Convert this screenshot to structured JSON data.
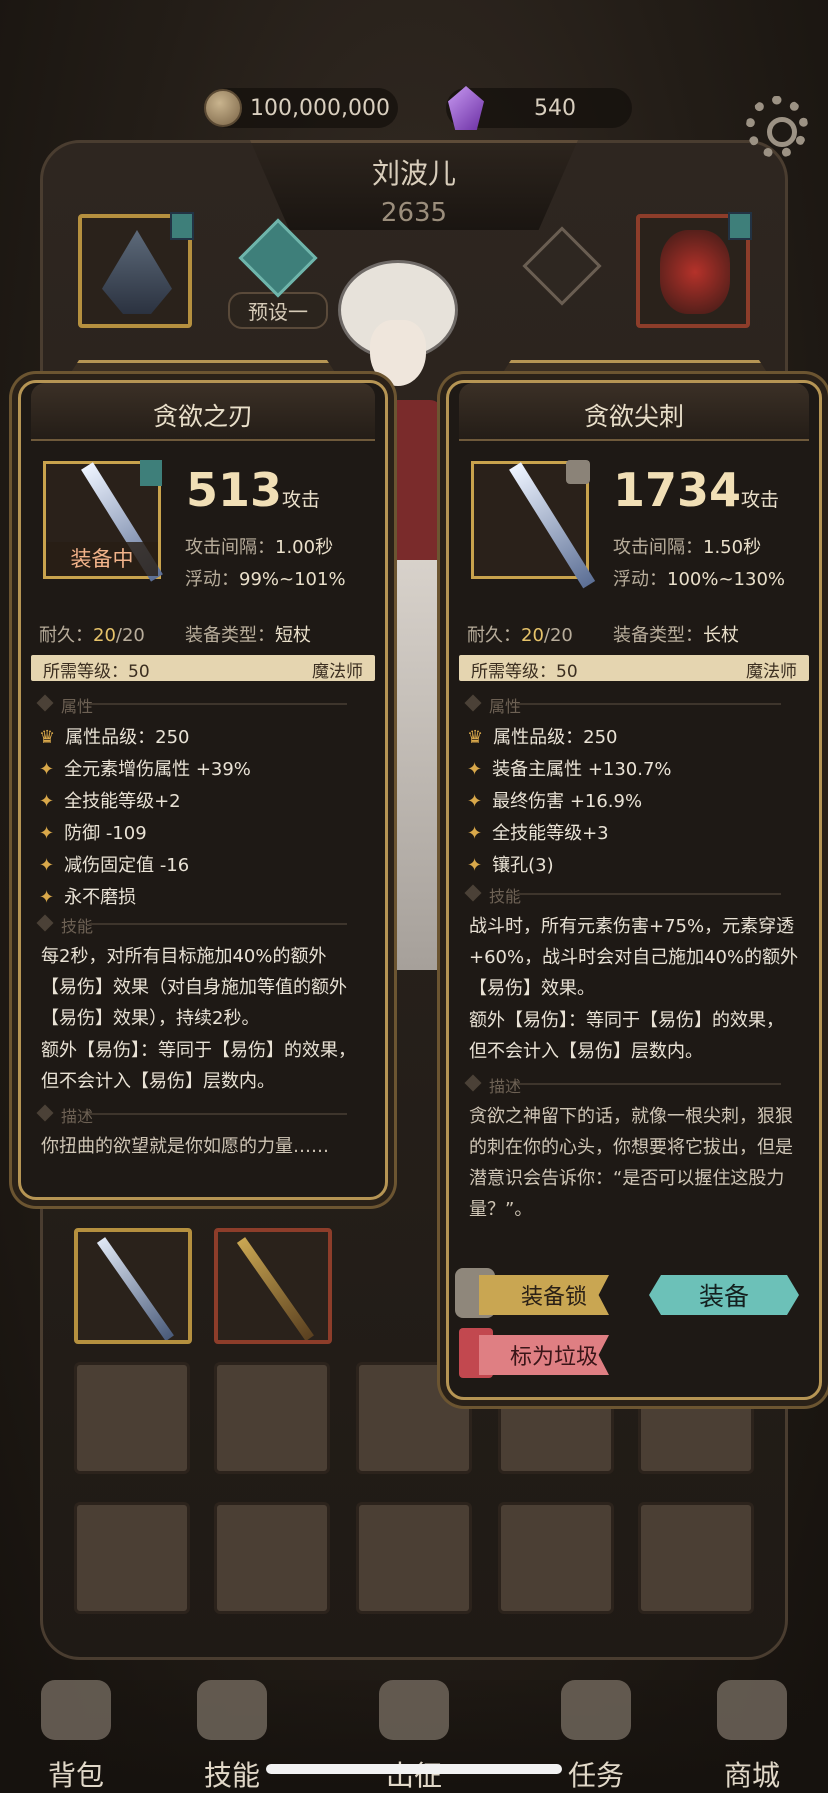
{
  "top_bar": {
    "gold": "100,000,000",
    "gems": "540",
    "icons": {
      "gold": "coin-icon",
      "gems": "crystal-icon",
      "settings": "gear-icon"
    }
  },
  "character": {
    "name": "刘波儿",
    "power": "2635",
    "preset_label": "预设一"
  },
  "panel_left": {
    "title": "贪欲之刃",
    "attack_value": "513",
    "attack_label": "攻击",
    "equipped_label": "装备中",
    "interval_key": "攻击间隔：",
    "interval_val": "1.00秒",
    "float_key": "浮动：",
    "float_val": "99%~101%",
    "durability_key": "耐久：",
    "durability_cur": "20",
    "durability_max": "/20",
    "type_key": "装备类型：",
    "type_val": "短杖",
    "req_level": "所需等级：50",
    "req_class": "魔法师",
    "section_attr": "属性",
    "attr_grade": "属性品级：250",
    "attrs": [
      "全元素增伤属性 +39%",
      "全技能等级+2",
      "防御 -109",
      "减伤固定值 -16",
      "永不磨损"
    ],
    "section_skill": "技能",
    "skill_text": "每2秒，对所有目标施加40%的额外【易伤】效果（对自身施加等值的额外【易伤】效果），持续2秒。",
    "skill_text2": "额外【易伤】：等同于【易伤】的效果，但不会计入【易伤】层数内。",
    "section_desc": "描述",
    "desc_text": "你扭曲的欲望就是你如愿的力量……"
  },
  "panel_right": {
    "title": "贪欲尖刺",
    "attack_value": "1734",
    "attack_label": "攻击",
    "interval_key": "攻击间隔：",
    "interval_val": "1.50秒",
    "float_key": "浮动：",
    "float_val": "100%~130%",
    "durability_key": "耐久：",
    "durability_cur": "20",
    "durability_max": "/20",
    "type_key": "装备类型：",
    "type_val": "长杖",
    "req_level": "所需等级：50",
    "req_class": "魔法师",
    "section_attr": "属性",
    "attr_grade": "属性品级：250",
    "attrs": [
      "装备主属性 +130.7%",
      "最终伤害 +16.9%",
      "全技能等级+3",
      "镶孔(3)"
    ],
    "section_skill": "技能",
    "skill_text": "战斗时，所有元素伤害+75%，元素穿透+60%，战斗时会对自己施加40%的额外【易伤】效果。",
    "skill_text2": "额外【易伤】：等同于【易伤】的效果，但不会计入【易伤】层数内。",
    "section_desc": "描述",
    "desc_text": "贪欲之神留下的话，就像一根尖刺，狠狠的刺在你的心头，你想要将它拔出，但是潜意识会告诉你：“是否可以握住这股力量？”。",
    "btn_lock": "装备锁",
    "btn_equip": "装备",
    "btn_trash": "标为垃圾"
  },
  "nav": {
    "items": [
      "背包",
      "技能",
      "出征",
      "任务",
      "商城"
    ]
  }
}
